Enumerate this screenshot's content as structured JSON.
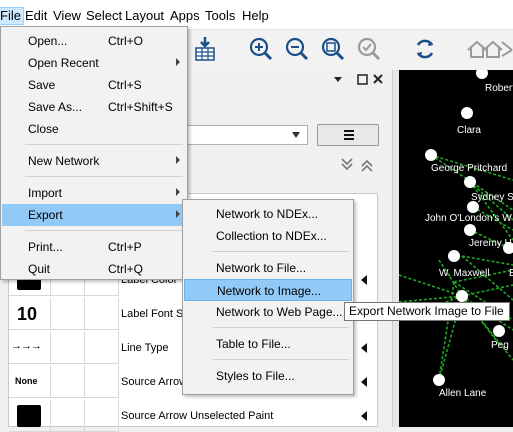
{
  "menubar": {
    "items": [
      "File",
      "Edit",
      "View",
      "Select",
      "Layout",
      "Apps",
      "Tools",
      "Help"
    ]
  },
  "toolbar": {
    "icons": [
      "import-table-icon",
      "zoom-in-icon",
      "zoom-out-icon",
      "zoom-fit-icon",
      "zoom-selected-icon",
      "refresh-icon",
      "home-icon"
    ]
  },
  "file_menu": {
    "items": [
      {
        "label": "Open...",
        "shortcut": "Ctrl+O"
      },
      {
        "label": "Open Recent",
        "shortcut": ""
      },
      {
        "label": "Save",
        "shortcut": "Ctrl+S"
      },
      {
        "label": "Save As...",
        "shortcut": "Ctrl+Shift+S"
      },
      {
        "label": "Close",
        "shortcut": ""
      },
      {
        "label": "New Network",
        "shortcut": ""
      },
      {
        "label": "Import",
        "shortcut": ""
      },
      {
        "label": "Export",
        "shortcut": ""
      },
      {
        "label": "Print...",
        "shortcut": "Ctrl+P"
      },
      {
        "label": "Quit",
        "shortcut": "Ctrl+Q"
      }
    ]
  },
  "export_menu": {
    "items": [
      "Network to NDEx...",
      "Collection to NDEx...",
      "Network to File...",
      "Network to Image...",
      "Network to Web Page...",
      "Table to File...",
      "Styles to File..."
    ]
  },
  "tooltip": "Export Network Image to File",
  "properties": [
    {
      "preview": "",
      "name": "Label Color"
    },
    {
      "preview": "10",
      "name": "Label Font Size"
    },
    {
      "preview": "→→→",
      "name": "Line Type"
    },
    {
      "preview": "None",
      "name": "Source Arrow Shape"
    },
    {
      "preview": "",
      "name": "Source Arrow Unselected Paint"
    }
  ],
  "network": {
    "node_labels": [
      "Robert",
      "Clara",
      "George Pritchard",
      "Sydney S",
      "John O'London's W",
      "Jeremy H",
      "W. Maxwell",
      "E",
      "Peg",
      "Allen Lane"
    ],
    "edge_color": "#1fa81f",
    "node_color": "#ffffff"
  }
}
